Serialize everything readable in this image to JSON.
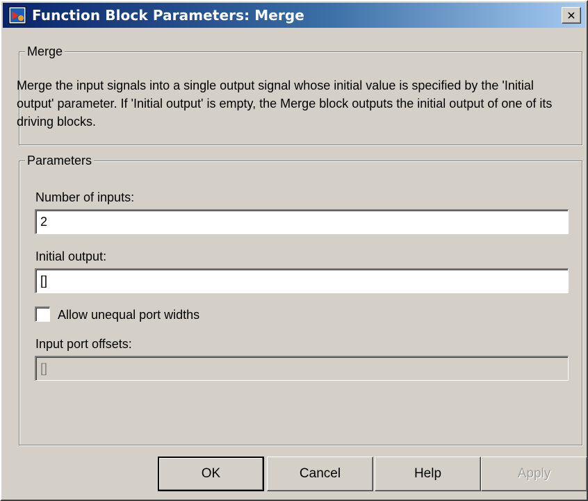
{
  "window": {
    "title": "Function Block Parameters: Merge",
    "close_symbol": "✕",
    "icon": "simulink-block-icon"
  },
  "merge_group": {
    "legend": "Merge",
    "description": "Merge the input signals into a single output signal whose initial value is specified by the 'Initial output' parameter. If 'Initial output' is empty, the Merge block outputs the initial output of one of its driving blocks."
  },
  "parameters_group": {
    "legend": "Parameters",
    "number_of_inputs": {
      "label": "Number of inputs:",
      "value": "2"
    },
    "initial_output": {
      "label": "Initial output:",
      "value": "[]"
    },
    "allow_unequal": {
      "label": "Allow unequal port widths",
      "checked": false
    },
    "input_port_offsets": {
      "label": "Input port offsets:",
      "value": "[]",
      "enabled": false
    }
  },
  "buttons": {
    "ok": "OK",
    "cancel": "Cancel",
    "help": "Help",
    "apply": "Apply"
  }
}
